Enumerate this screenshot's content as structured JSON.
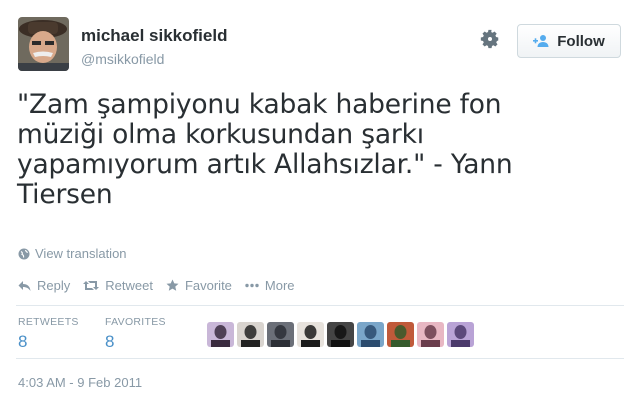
{
  "user": {
    "name": "michael sikkofield",
    "handle": "@msikkofield"
  },
  "header": {
    "follow_label": "Follow",
    "settings_icon": "gear-icon",
    "follow_icon": "add-user-icon"
  },
  "tweet": {
    "text": "\"Zam şampiyonu kabak haberine fon müziği olma korkusundan şarkı yapamıyorum artık Allahsızlar.\" - Yann Tiersen",
    "translate_label": "View translation"
  },
  "actions": {
    "reply": "Reply",
    "retweet": "Retweet",
    "favorite": "Favorite",
    "more": "More"
  },
  "stats": {
    "retweets_label": "RETWEETS",
    "retweets_value": "8",
    "favorites_label": "FAVORITES",
    "favorites_value": "8"
  },
  "favoriters": [
    {
      "colors": [
        "#c9b7d8",
        "#3a2b3f"
      ]
    },
    {
      "colors": [
        "#d9d4cf",
        "#222222"
      ]
    },
    {
      "colors": [
        "#6b6f78",
        "#2c2f36"
      ]
    },
    {
      "colors": [
        "#e7e2dc",
        "#1b1b1b"
      ]
    },
    {
      "colors": [
        "#454545",
        "#111111"
      ]
    },
    {
      "colors": [
        "#7aa6c9",
        "#2b4b6e"
      ]
    },
    {
      "colors": [
        "#c05a3a",
        "#355a2c"
      ]
    },
    {
      "colors": [
        "#e8b7c3",
        "#6a3d4c"
      ]
    },
    {
      "colors": [
        "#b9a3d6",
        "#4b3a6b"
      ]
    }
  ],
  "timestamp": "4:03 AM - 9 Feb 2011",
  "colors": {
    "link": "#4a90c8",
    "muted": "#8899a6",
    "text": "#292f33"
  }
}
